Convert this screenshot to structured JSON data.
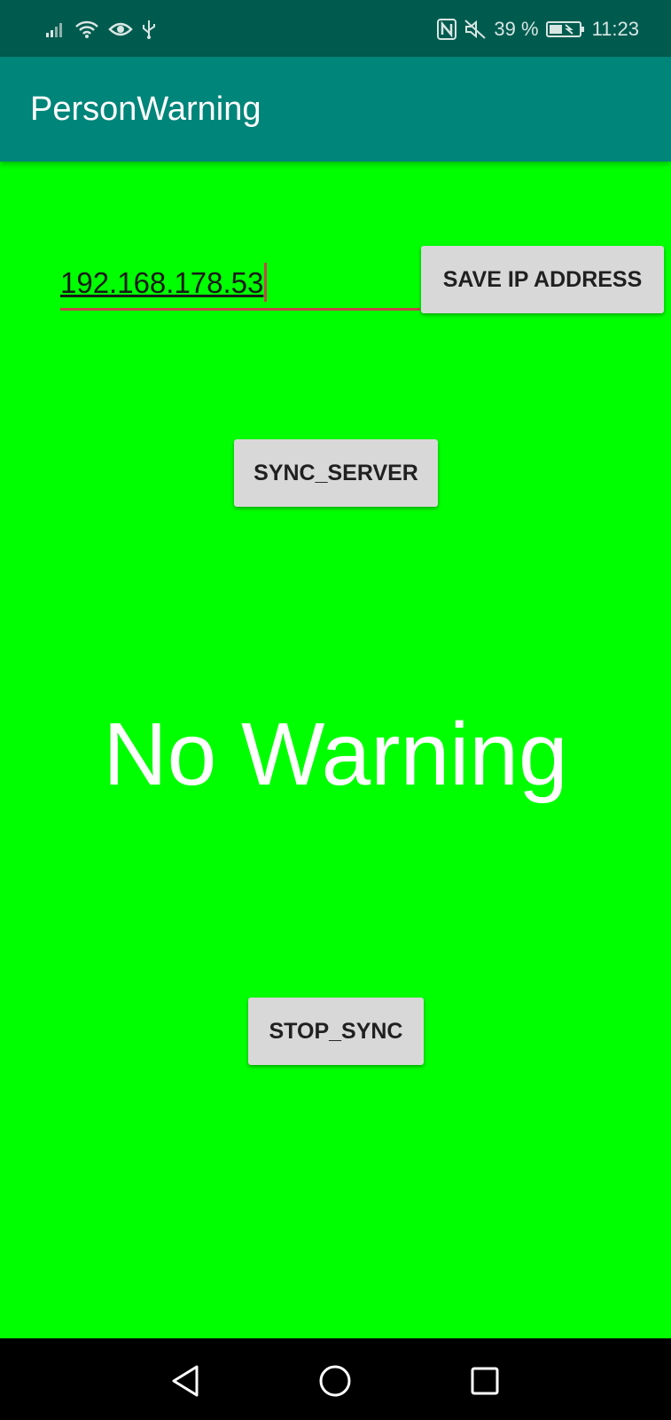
{
  "status_bar": {
    "battery_percent": "39 %",
    "time": "11:23",
    "icons": [
      "signal-icon",
      "wifi-icon",
      "eye-icon",
      "usb-icon",
      "nfc-icon",
      "mute-icon",
      "battery-icon"
    ]
  },
  "app_bar": {
    "title": "PersonWarning"
  },
  "ip_input": {
    "value": "192.168.178.53"
  },
  "buttons": {
    "save_ip": "SAVE IP ADDRESS",
    "sync_server": "SYNC_SERVER",
    "stop_sync": "STOP_SYNC"
  },
  "warning": {
    "text": "No Warning"
  },
  "colors": {
    "background": "#00ff00",
    "app_bar": "#00857a",
    "status_bar": "#005b4f",
    "button": "#d8d8d8",
    "input_underline": "#c0464a"
  },
  "nav_bar": {
    "icons": [
      "back-icon",
      "home-icon",
      "recent-apps-icon"
    ]
  }
}
